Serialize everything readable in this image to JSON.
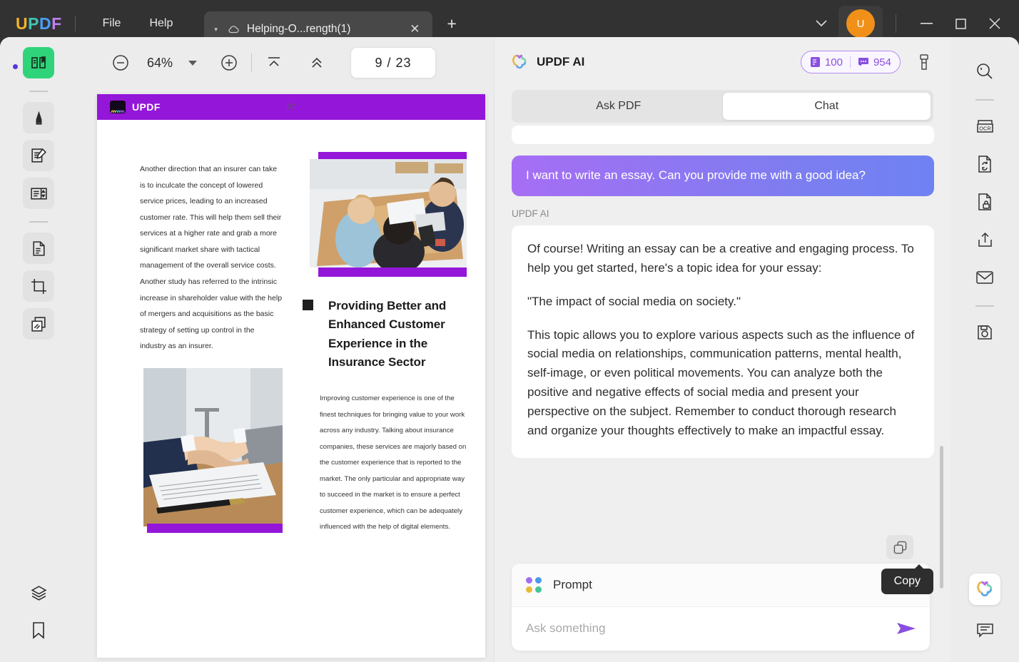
{
  "titlebar": {
    "brand": [
      "U",
      "P",
      "D",
      "F"
    ],
    "menus": [
      {
        "label": "File",
        "name": "menu-file"
      },
      {
        "label": "Help",
        "name": "menu-help"
      }
    ],
    "tab": {
      "title": "Helping-O...rength(1)",
      "close": "✕",
      "caret": "▾"
    },
    "new_tab": "+",
    "avatar_letter": "U",
    "window": {
      "chevron": "⌄",
      "minimize": "—",
      "maximize": "□",
      "close": "✕"
    }
  },
  "left_rail": {
    "items": [
      {
        "name": "sidebar-reader",
        "icon": "book-reader-icon",
        "state": "active"
      },
      {
        "name": "sidebar-annotate",
        "icon": "highlighter-icon",
        "state": "shaded"
      },
      {
        "name": "sidebar-edit-pdf",
        "icon": "edit-document-icon",
        "state": "shaded"
      },
      {
        "name": "sidebar-page-tools",
        "icon": "page-layout-icon",
        "state": "shaded"
      },
      {
        "name": "sidebar-convert",
        "icon": "convert-file-icon",
        "state": "shaded"
      },
      {
        "name": "sidebar-crop",
        "icon": "crop-icon",
        "state": "shaded"
      },
      {
        "name": "sidebar-organize",
        "icon": "organize-pages-icon",
        "state": "shaded"
      },
      {
        "name": "sidebar-layers",
        "icon": "layers-icon",
        "state": "plain"
      },
      {
        "name": "sidebar-bookmark",
        "icon": "bookmark-icon",
        "state": "plain"
      }
    ]
  },
  "toolbar": {
    "zoom_out": "zoom-out-icon",
    "zoom_level": "64%",
    "zoom_in": "zoom-in-icon",
    "fit_page": "fit-page-icon",
    "scroll_up": "double-chevron-up-icon",
    "page_current": "9",
    "page_separator": "/",
    "page_total": "23",
    "page_display": "9  /  23"
  },
  "document": {
    "header_logo_text": "UPDF",
    "paragraph_left": "Another direction that an insurer can take is to inculcate the concept of lowered service prices, leading to an increased customer rate. This will help them sell their services at a higher rate and grab a more significant market share with tactical management of the overall service costs. Another study has referred to the intrinsic increase in shareholder value with the help of mergers and acquisitions as the basic strategy of setting up control in the industry as an insurer.",
    "heading": "Providing Better and Enhanced Customer Experience in the Insurance Sector",
    "paragraph_right": "Improving customer experience is one of the finest techniques for bringing value to your work across any industry. Talking about insurance companies, these services are majorly based on the customer experience that is reported to the market. The only particular and appropriate way to succeed in the market is to ensure a perfect customer experience, which can be adequately influenced with the help of digital elements.",
    "page_number": "07",
    "accent_color": "#9416d8",
    "image_meeting_alt": "business-meeting-photo",
    "image_handshake_alt": "handshake-contract-photo"
  },
  "ai_panel": {
    "title": "UPDF AI",
    "credits": {
      "pages_value": "100",
      "messages_value": "954",
      "pages_icon": "document-credit-icon",
      "messages_icon": "chat-credit-icon"
    },
    "clean_icon": "clean-brush-icon",
    "tabs": [
      {
        "label": "Ask PDF",
        "name": "tab-ask-pdf",
        "active": false
      },
      {
        "label": "Chat",
        "name": "tab-chat",
        "active": true
      }
    ],
    "messages": {
      "user": "I want to write an essay. Can you provide me with a good idea?",
      "assistant_label": "UPDF AI",
      "assistant_paragraphs": [
        "Of course! Writing an essay can be a creative and engaging process. To help you get started, here's a topic idea for your essay:",
        "\"The impact of social media on society.\"",
        "This topic allows you to explore various aspects such as the influence of social media on relationships, communication patterns, mental health, self-image, or even political movements. You can analyze both the positive and negative effects of social media and present your perspective on the subject. Remember to conduct thorough research and organize your thoughts effectively to make an impactful essay."
      ]
    },
    "copy_tooltip": "Copy",
    "copy_icon": "copy-icon",
    "prompt": {
      "label": "Prompt",
      "caret": "▾",
      "input_value": "",
      "input_placeholder": "Ask something",
      "send_icon": "send-icon"
    },
    "accent_color": "#8a4fe0"
  },
  "right_rail": {
    "items": [
      {
        "name": "search-icon",
        "label": "Search"
      },
      {
        "name": "ocr-icon",
        "label": "OCR"
      },
      {
        "name": "convert-icon",
        "label": "Convert"
      },
      {
        "name": "protect-icon",
        "label": "Protect"
      },
      {
        "name": "share-icon",
        "label": "Share"
      },
      {
        "name": "email-icon",
        "label": "Email"
      },
      {
        "name": "save-icon",
        "label": "Save"
      }
    ],
    "ai_float_icon": "updf-ai-icon",
    "comment_icon": "comment-icon"
  }
}
